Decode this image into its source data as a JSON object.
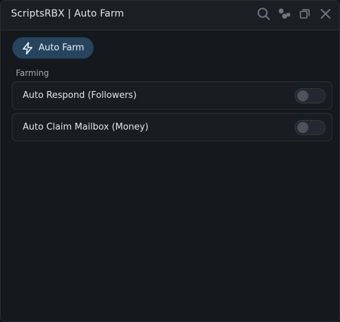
{
  "window": {
    "title": "ScriptsRBX | Auto Farm",
    "controls": [
      "search-icon",
      "settings-icon",
      "minimize-icon",
      "close-icon"
    ]
  },
  "tabs": [
    {
      "label": "Auto Farm",
      "icon": "bolt-icon",
      "active": true
    }
  ],
  "section": {
    "label": "Farming"
  },
  "toggles": [
    {
      "label": "Auto Respond (Followers)",
      "enabled": false
    },
    {
      "label": "Auto Claim Mailbox (Money)",
      "enabled": false
    }
  ],
  "colors": {
    "background": "#15191d",
    "accent_tab": "#27445f",
    "text": "#e3e6ea",
    "muted_text": "#a7adb4"
  }
}
